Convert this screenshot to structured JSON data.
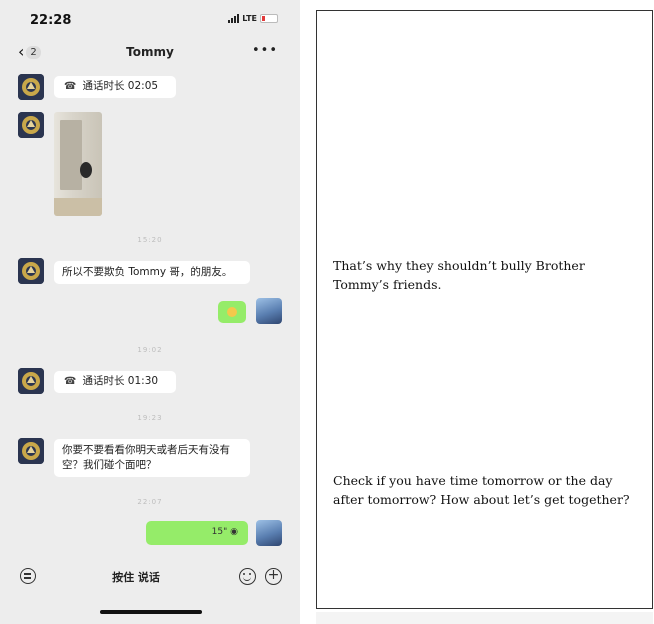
{
  "status_bar": {
    "time": "22:28",
    "network": "LTE"
  },
  "nav": {
    "back_count": "2",
    "title": "Tommy",
    "more": "•••"
  },
  "messages": {
    "call_1": "通话时长 02:05",
    "timestamp_1": "15:20",
    "text_1": "所以不要欺负 Tommy 哥，的朋友。",
    "timestamp_2": "19:02",
    "call_2": "通话时长 01:30",
    "timestamp_3": "19:23",
    "text_2": "你要不要看看你明天或者后天有没有空？我们碰个面吧？",
    "timestamp_4": "22:07",
    "voice_duration": "15\""
  },
  "input_bar": {
    "hold_to_talk": "按住 说话"
  },
  "translations": {
    "t1": "That’s why they shouldn’t bully Brother Tommy’s friends.",
    "t2": "Check if you have time tomorrow or the day after tomorrow? How about let’s get together?"
  },
  "colors": {
    "chat_background": "#ededed",
    "bubble_white": "#ffffff",
    "bubble_green": "#95ec69"
  },
  "icons": [
    "back-chevron-icon",
    "more-icon",
    "phone-call-icon",
    "voice-mode-icon",
    "emoji-icon",
    "plus-icon",
    "battery-icon",
    "signal-icon"
  ]
}
